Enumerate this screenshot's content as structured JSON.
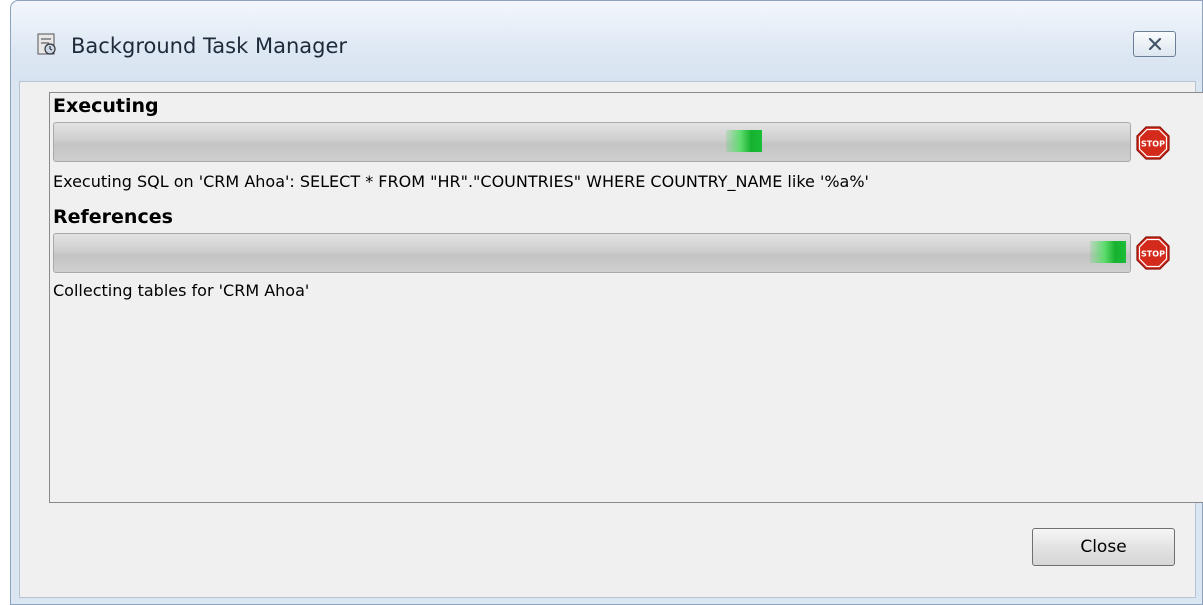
{
  "window": {
    "title": "Background Task Manager"
  },
  "tasks": [
    {
      "heading": "Executing",
      "description": "Executing SQL on 'CRM Ahoa': SELECT * FROM \"HR\".\"COUNTRIES\" WHERE COUNTRY_NAME like '%a%'",
      "progress_state": "indeterminate",
      "stop_icon": "stop-sign-icon"
    },
    {
      "heading": "References",
      "description": "Collecting tables for 'CRM Ahoa'",
      "progress_state": "indeterminate",
      "stop_icon": "stop-sign-icon"
    }
  ],
  "footer": {
    "close_label": "Close"
  },
  "colors": {
    "progress_chunk": "#1bbd36",
    "stop_sign": "#d42a1c",
    "title_bar": "#dee8f4"
  }
}
